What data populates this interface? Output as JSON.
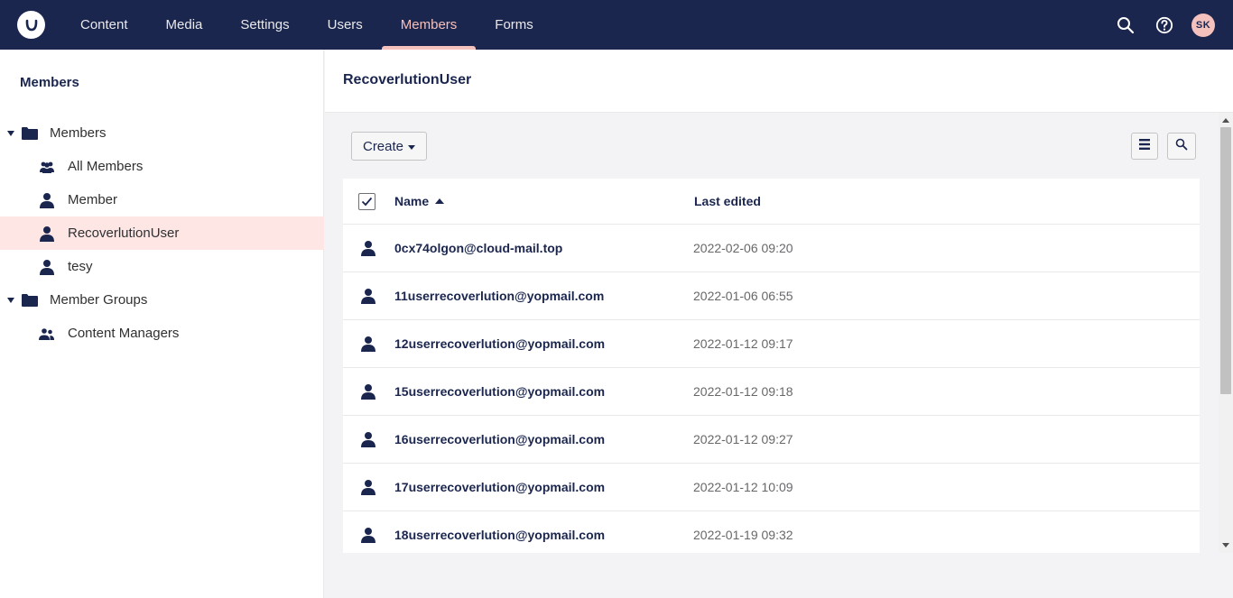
{
  "header": {
    "nav": [
      {
        "label": "Content"
      },
      {
        "label": "Media"
      },
      {
        "label": "Settings"
      },
      {
        "label": "Users"
      },
      {
        "label": "Members",
        "active": true
      },
      {
        "label": "Forms"
      }
    ],
    "avatar_initials": "SK",
    "colors": {
      "bar": "#1b264f",
      "accent": "#f5c1bc"
    }
  },
  "sidebar": {
    "title": "Members",
    "tree": [
      {
        "label": "Members",
        "icon": "folder-icon",
        "level": 0,
        "expanded": true
      },
      {
        "label": "All Members",
        "icon": "users-icon",
        "level": 1
      },
      {
        "label": "Member",
        "icon": "user-icon",
        "level": 1
      },
      {
        "label": "RecoverlutionUser",
        "icon": "user-icon",
        "level": 1,
        "selected": true
      },
      {
        "label": "tesy",
        "icon": "user-icon",
        "level": 1
      },
      {
        "label": "Member Groups",
        "icon": "folder-icon",
        "level": 0,
        "expanded": true
      },
      {
        "label": "Content Managers",
        "icon": "users-icon",
        "level": 1
      }
    ]
  },
  "main": {
    "title": "RecoverlutionUser",
    "create_label": "Create",
    "columns": {
      "name": "Name",
      "last_edited": "Last edited"
    },
    "rows": [
      {
        "name": "0cx74olgon@cloud-mail.top",
        "date": "2022-02-06 09:20"
      },
      {
        "name": "11userrecoverlution@yopmail.com",
        "date": "2022-01-06 06:55"
      },
      {
        "name": "12userrecoverlution@yopmail.com",
        "date": "2022-01-12 09:17"
      },
      {
        "name": "15userrecoverlution@yopmail.com",
        "date": "2022-01-12 09:18"
      },
      {
        "name": "16userrecoverlution@yopmail.com",
        "date": "2022-01-12 09:27"
      },
      {
        "name": "17userrecoverlution@yopmail.com",
        "date": "2022-01-12 10:09"
      },
      {
        "name": "18userrecoverlution@yopmail.com",
        "date": "2022-01-19 09:32"
      }
    ]
  }
}
